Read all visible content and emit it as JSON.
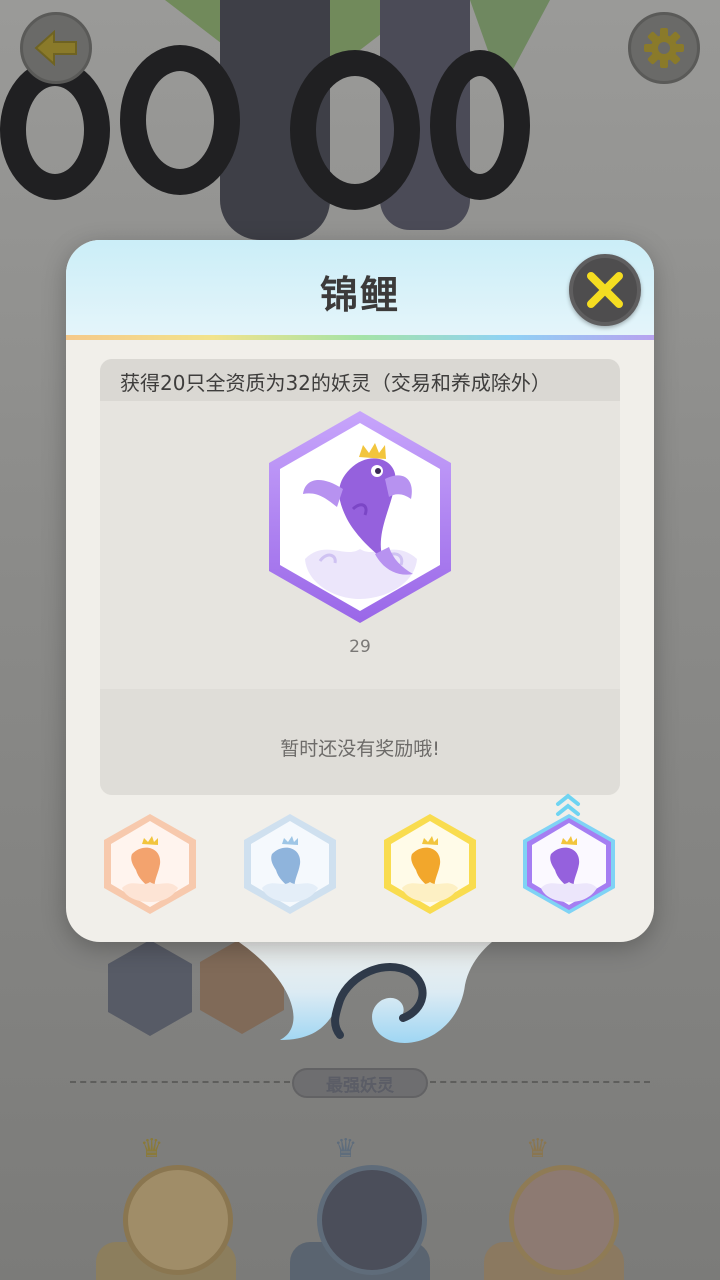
{
  "dialog": {
    "title": "锦鲤",
    "condition": "获得20只全资质为32的妖灵（交易和养成除外）",
    "progress": "29",
    "reward_message": "暂时还没有奖励哦!"
  },
  "tiers": [
    {
      "name": "bronze",
      "color": "#f3b691"
    },
    {
      "name": "silver",
      "color": "#b9d6ee"
    },
    {
      "name": "gold",
      "color": "#f7d34a"
    },
    {
      "name": "purple",
      "color": "#a77ef0",
      "selected": true
    }
  ],
  "background": {
    "section_label": "最强妖灵"
  },
  "colors": {
    "accent_purple": "#9b6ce6",
    "close_icon": "#f5dd21",
    "back_arrow": "#d8b51a"
  },
  "icons": [
    "back-arrow-icon",
    "settings-gear-icon",
    "close-icon",
    "koi-fish-icon",
    "chevron-up-icon"
  ]
}
